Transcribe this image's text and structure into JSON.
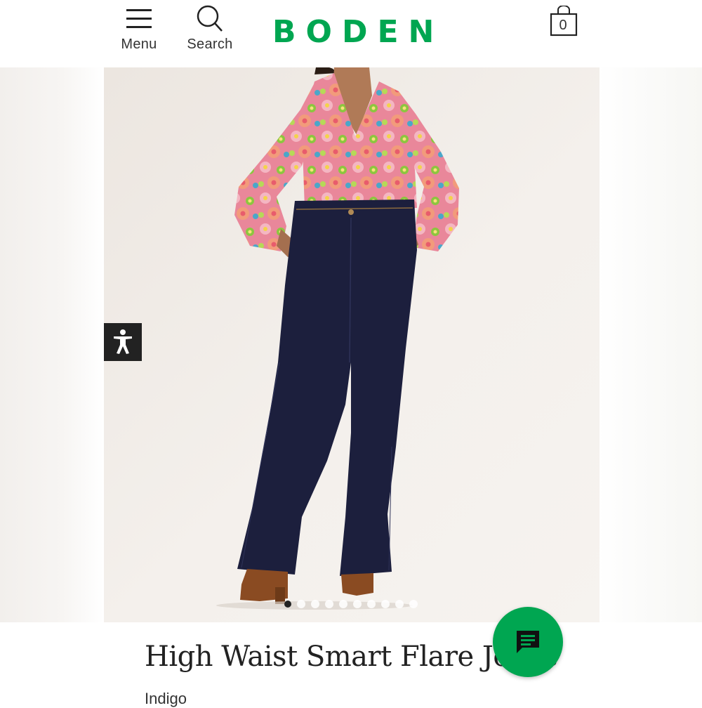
{
  "header": {
    "menu_label": "Menu",
    "search_label": "Search",
    "brand": "BODEN",
    "bag_count": "0"
  },
  "product": {
    "title": "High Waist Smart Flare Jeans",
    "colour": "Indigo"
  },
  "carousel": {
    "total_images": 10,
    "active_index": 0
  },
  "icons": {
    "menu": "hamburger-icon",
    "search": "search-icon",
    "bag": "shopping-bag-icon",
    "accessibility": "accessibility-icon",
    "chat": "chat-icon"
  },
  "colors": {
    "brand_green": "#00a651",
    "jeans_indigo": "#1c1f3d"
  }
}
